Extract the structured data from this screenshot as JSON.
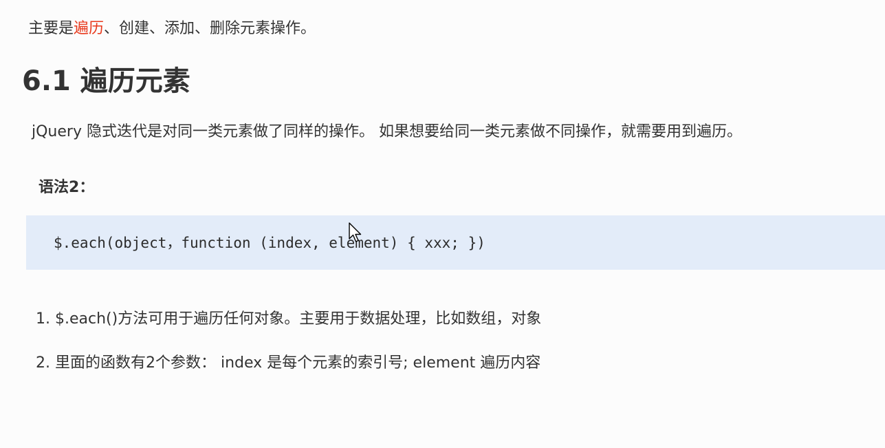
{
  "intro": {
    "prefix": "主要是",
    "highlight": "遍历",
    "suffix": "、创建、添加、删除元素操作。"
  },
  "section": {
    "title": "6.1 遍历元素"
  },
  "description": "jQuery 隐式迭代是对同一类元素做了同样的操作。 如果想要给同一类元素做不同操作，就需要用到遍历。",
  "syntax": {
    "label": "语法2：",
    "code": "$.each(object，function (index, element) { xxx; })"
  },
  "notes": [
    {
      "text": "1. $.each()方法可用于遍历任何对象。主要用于数据处理，比如数组，对象"
    },
    {
      "text": "2. 里面的函数有2个参数： index 是每个元素的索引号; element  遍历内容"
    }
  ],
  "colors": {
    "highlight": "#e8381b",
    "code_background": "#e3ecf9",
    "text": "#333333"
  },
  "icons": {
    "cursor": "mouse-pointer-icon"
  }
}
